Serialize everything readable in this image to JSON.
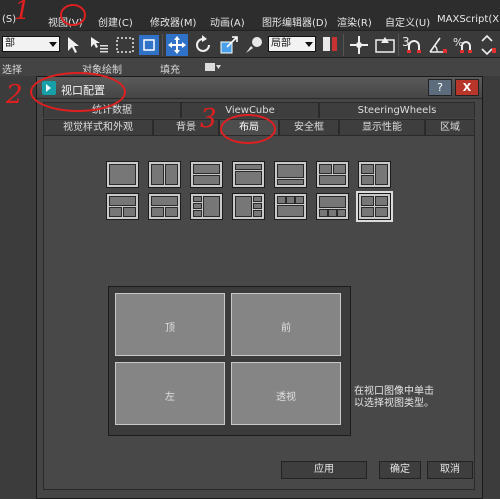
{
  "menubar": {
    "items": [
      "(S)",
      "视图(V)",
      "创建(C)",
      "修改器(M)",
      "动画(A)",
      "图形编辑器(D)",
      "渲染(R)",
      "自定义(U)",
      "MAXScript(X)"
    ]
  },
  "toolbar": {
    "left_combo": "部",
    "ref_combo": "局部",
    "snap_label": "3",
    "percent_label": "%"
  },
  "ribbon": {
    "items": [
      "选择",
      "对象绘制",
      "填充"
    ]
  },
  "dialog": {
    "title": "视口配置",
    "help_label": "?",
    "close_label": "X",
    "tabs_row1": [
      "统计数据",
      "ViewCube",
      "SteeringWheels"
    ],
    "tabs_row2": [
      "视觉样式和外观",
      "背景",
      "布局",
      "安全框",
      "显示性能",
      "区域"
    ],
    "active_tab": "布局",
    "viewports": [
      "顶",
      "前",
      "左",
      "透视"
    ],
    "hint": "在视口图像中单击\n以选择视图类型。",
    "buttons": {
      "apply": "应用",
      "ok": "确定",
      "cancel": "取消"
    }
  },
  "annotations": {
    "step1": "1",
    "step2": "2",
    "step3": "3",
    "color": "#e02020"
  },
  "colors": {
    "dialog_bg": "#454545",
    "close_button": "#b8352a",
    "accent_icon": "#18a0a8"
  }
}
